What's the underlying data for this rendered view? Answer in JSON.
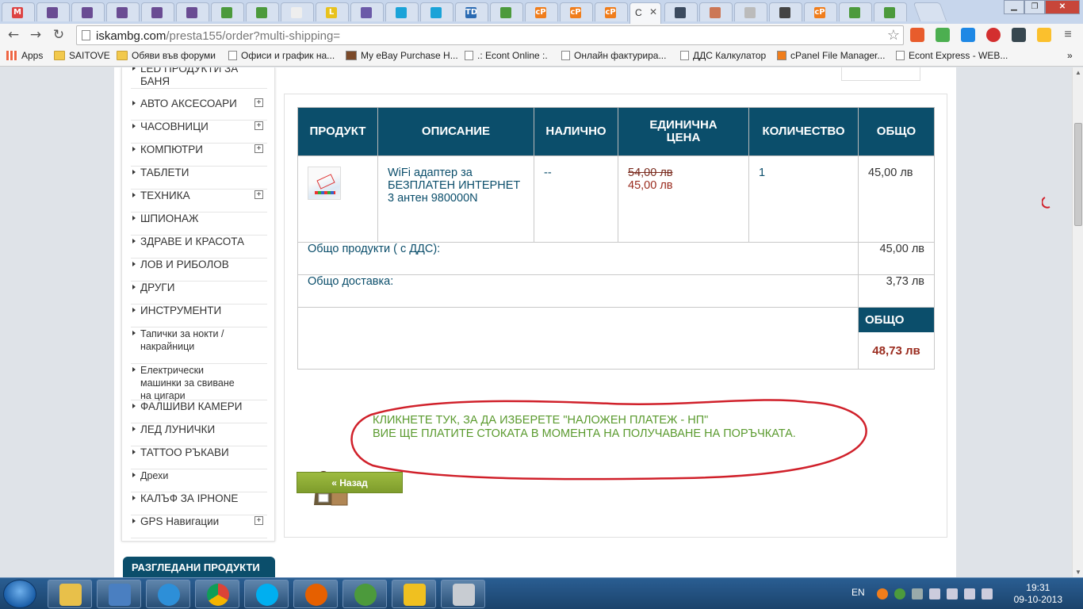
{
  "browser": {
    "url_host": "iskambg.com",
    "url_path": "/presta155/order?multi-shipping=",
    "active_tab_text": "C",
    "tab_favicons": [
      {
        "glyph": "M",
        "color": "#d44"
      },
      {
        "glyph": "",
        "color": "#6a4c93"
      },
      {
        "glyph": "",
        "color": "#6a4c93"
      },
      {
        "glyph": "",
        "color": "#6a4c93"
      },
      {
        "glyph": "",
        "color": "#6a4c93"
      },
      {
        "glyph": "",
        "color": "#6a4c93"
      },
      {
        "glyph": "",
        "color": "#4c9a3c"
      },
      {
        "glyph": "",
        "color": "#4c9a3c"
      },
      {
        "glyph": "",
        "color": "#eee"
      },
      {
        "glyph": "L",
        "color": "#e8c21d"
      },
      {
        "glyph": "",
        "color": "#6b5aa8"
      },
      {
        "glyph": "",
        "color": "#1aa3d8"
      },
      {
        "glyph": "",
        "color": "#1aa3d8"
      },
      {
        "glyph": "TD",
        "color": "#2a6ab2"
      },
      {
        "glyph": "",
        "color": "#4c9a3c"
      },
      {
        "glyph": "cP",
        "color": "#f07d1b"
      },
      {
        "glyph": "cP",
        "color": "#f07d1b"
      },
      {
        "glyph": "cP",
        "color": "#f07d1b"
      },
      {
        "glyph": "",
        "color": "#3b4a5e"
      },
      {
        "glyph": "",
        "color": "#c75"
      },
      {
        "glyph": "",
        "color": "#bbb"
      },
      {
        "glyph": "",
        "color": "#444"
      },
      {
        "glyph": "cP",
        "color": "#f07d1b"
      },
      {
        "glyph": "",
        "color": "#4c9a3c"
      },
      {
        "glyph": "",
        "color": "#4c9a3c"
      }
    ],
    "bookmarks": [
      {
        "label": "Apps",
        "icon": "apps-icon"
      },
      {
        "label": "SAITOVE",
        "icon": "folder-icon"
      },
      {
        "label": "Обяви във форуми",
        "icon": "folder-icon"
      },
      {
        "label": "Офиси и график на...",
        "icon": "page-icon"
      },
      {
        "label": "My eBay Purchase H...",
        "icon": "ebay-icon"
      },
      {
        "label": ".: Econt Online :.",
        "icon": "econt-icon"
      },
      {
        "label": "Онлайн фактурира...",
        "icon": "page-icon"
      },
      {
        "label": "ДДС Калкулатор",
        "icon": "page-icon"
      },
      {
        "label": "cPanel File Manager...",
        "icon": "cpanel-icon"
      },
      {
        "label": "Econt Express - WEB...",
        "icon": "page-icon"
      }
    ]
  },
  "sidebar": {
    "categories": [
      {
        "label": "LED ПРОДУКТИ ЗА БАНЯ",
        "expandable": false
      },
      {
        "label": "АВТО АКСЕСОАРИ",
        "expandable": true
      },
      {
        "label": "ЧАСОВНИЦИ",
        "expandable": true
      },
      {
        "label": "КОМПЮТРИ",
        "expandable": true
      },
      {
        "label": "ТАБЛЕТИ",
        "expandable": false
      },
      {
        "label": "ТЕХНИКА",
        "expandable": true
      },
      {
        "label": "ШПИОНАЖ",
        "expandable": false
      },
      {
        "label": "ЗДРАВЕ И КРАСОТА",
        "expandable": false
      },
      {
        "label": "ЛОВ И РИБОЛОВ",
        "expandable": false
      },
      {
        "label": "ДРУГИ",
        "expandable": false
      },
      {
        "label": "ИНСТРУМЕНТИ",
        "expandable": false
      },
      {
        "label": "Тапички за нокти / накрайници",
        "expandable": false
      },
      {
        "label": "Електрически машинки за свиване на цигари",
        "expandable": false
      },
      {
        "label": "ФАЛШИВИ КАМЕРИ",
        "expandable": false
      },
      {
        "label": "ЛЕД ЛУНИЧКИ",
        "expandable": false
      },
      {
        "label": "ТАТТОО РЪКАВИ",
        "expandable": false
      },
      {
        "label": "Дрехи",
        "expandable": false
      },
      {
        "label": "КАЛЪФ ЗА IPHONE",
        "expandable": false
      },
      {
        "label": "GPS Навигации",
        "expandable": true
      }
    ],
    "viewed_products_title": "РАЗГЛЕДАНИ ПРОДУКТИ"
  },
  "cart": {
    "headers": [
      "ПРОДУКТ",
      "ОПИСАНИЕ",
      "НАЛИЧНО",
      "ЕДИНИЧНА ЦЕНА",
      "КОЛИЧЕСТВО",
      "ОБЩО"
    ],
    "item": {
      "description": "WiFi адаптер за БЕЗПЛАТЕН ИНТЕРНЕТ 3 антен 980000N",
      "availability": "--",
      "old_price": "54,00 лв",
      "price": "45,00 лв",
      "quantity": "1",
      "total": "45,00 лв"
    },
    "products_total_label": "Общо продукти ( с ДДС):",
    "products_total": "45,00 лв",
    "shipping_label": "Общо доставка:",
    "shipping_total": "3,73 лв",
    "grand_total_label": "ОБЩО",
    "grand_total": "48,73 лв"
  },
  "payment": {
    "cod_line1": "КЛИКНЕТЕ ТУК, ЗА ДА ИЗБЕРЕТЕ \"НАЛОЖЕН ПЛАТЕЖ - НП\"",
    "cod_line2": "ВИЕ ЩЕ ПЛАТИТЕ СТОКАТА В МОМЕНТА НА ПОЛУЧАВАНЕ НА ПОРЪЧКАТА.",
    "back_label": "« Назад"
  },
  "taskbar": {
    "language": "EN",
    "time": "19:31",
    "date": "09-10-2013"
  },
  "colors": {
    "header_blue": "#0b4e6b",
    "price_red": "#9a2b1e",
    "cod_green": "#5a9a2e",
    "back_button_green": "#8aa834",
    "annotation_red": "#d0202a"
  }
}
